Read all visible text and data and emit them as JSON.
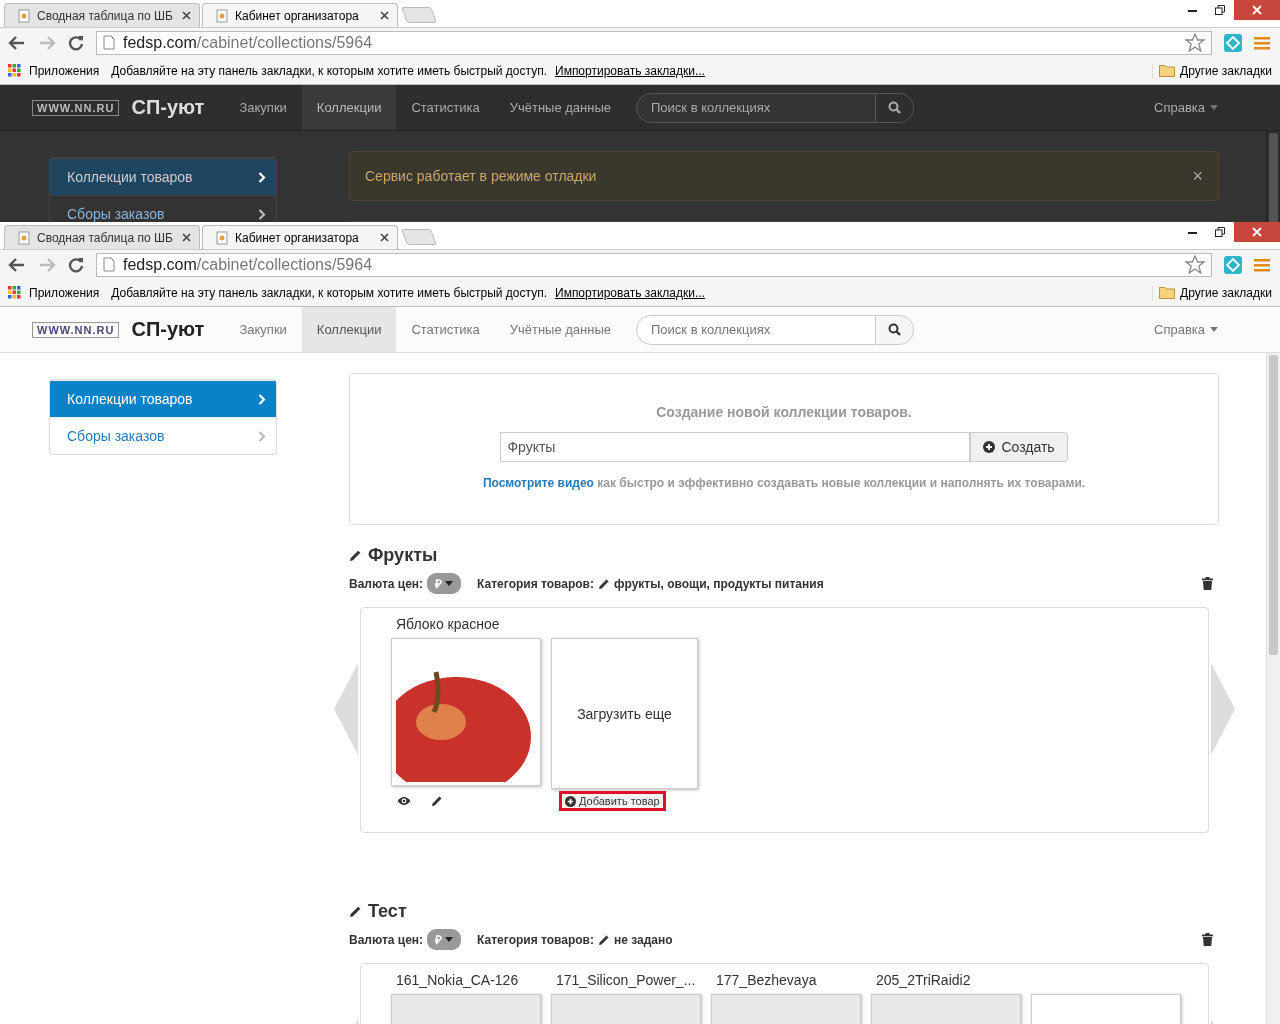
{
  "windows": [
    {
      "dimmed": true,
      "tabs": [
        {
          "title": "Сводная таблица по ШБ",
          "selected": false
        },
        {
          "title": "Кабинет организатора",
          "selected": true
        }
      ],
      "url": {
        "host": "fedsp.com",
        "path": "/cabinet/collections/5964"
      },
      "bookmarks": {
        "apps": "Приложения",
        "hint": "Добавляйте на эту панель закладки, к которым хотите иметь быстрый доступ.",
        "import_link": "Импортировать закладки...",
        "other": "Другие закладки"
      },
      "site": {
        "logo": "WWW.NN.RU",
        "brand": "СП-уют",
        "nav": [
          {
            "label": "Закупки",
            "selected": false
          },
          {
            "label": "Коллекции",
            "selected": true
          },
          {
            "label": "Статистика",
            "selected": false
          },
          {
            "label": "Учётные данные",
            "selected": false
          }
        ],
        "search_placeholder": "Поиск в коллекциях",
        "help": "Справка"
      },
      "sidebar": [
        {
          "label": "Коллекции товаров",
          "selected": true
        },
        {
          "label": "Сборы заказов",
          "selected": false
        }
      ],
      "alert": {
        "text": "Сервис работает в режиме отладки",
        "close": "×"
      }
    },
    {
      "dimmed": false,
      "tabs": [
        {
          "title": "Сводная таблица по ШБ",
          "selected": false
        },
        {
          "title": "Кабинет организатора",
          "selected": true
        }
      ],
      "url": {
        "host": "fedsp.com",
        "path": "/cabinet/collections/5964"
      },
      "bookmarks": {
        "apps": "Приложения",
        "hint": "Добавляйте на эту панель закладки, к которым хотите иметь быстрый доступ.",
        "import_link": "Импортировать закладки...",
        "other": "Другие закладки"
      },
      "site": {
        "logo": "WWW.NN.RU",
        "brand": "СП-уют",
        "nav": [
          {
            "label": "Закупки",
            "selected": false
          },
          {
            "label": "Коллекции",
            "selected": true
          },
          {
            "label": "Статистика",
            "selected": false
          },
          {
            "label": "Учётные данные",
            "selected": false
          }
        ],
        "search_placeholder": "Поиск в коллекциях",
        "help": "Справка"
      },
      "sidebar": [
        {
          "label": "Коллекции товаров",
          "selected": true
        },
        {
          "label": "Сборы заказов",
          "selected": false
        }
      ],
      "create_form": {
        "title": "Создание новой коллекции товаров.",
        "value": "Фрукты",
        "button": "Создать",
        "video_link": "Посмотрите видео",
        "video_text": "как быстро и эффективно создавать новые коллекции и наполнять их товарами."
      },
      "collections": [
        {
          "title": "Фрукты",
          "currency_label": "Валюта цен:",
          "currency": "₽",
          "category_label": "Категория товаров:",
          "category": "фрукты, овощи, продукты питания",
          "load_more": "Загрузить еще",
          "add_button": {
            "label": "Добавить товар",
            "highlighted": true
          },
          "products": [
            {
              "name": "Яблоко красное",
              "kind": "apple"
            }
          ]
        },
        {
          "title": "Тест",
          "currency_label": "Валюта цен:",
          "currency": "₽",
          "category_label": "Категория товаров:",
          "category": "не задано",
          "products": [
            {
              "name": "161_Nokia_CA-126",
              "kind": "photo"
            },
            {
              "name": "171_Silicon_Power_...",
              "kind": "photo"
            },
            {
              "name": "177_Bezhevaya",
              "kind": "photo"
            },
            {
              "name": "205_2TriRaidi2",
              "kind": "photo"
            },
            {
              "kind": "blank"
            }
          ]
        }
      ]
    }
  ]
}
